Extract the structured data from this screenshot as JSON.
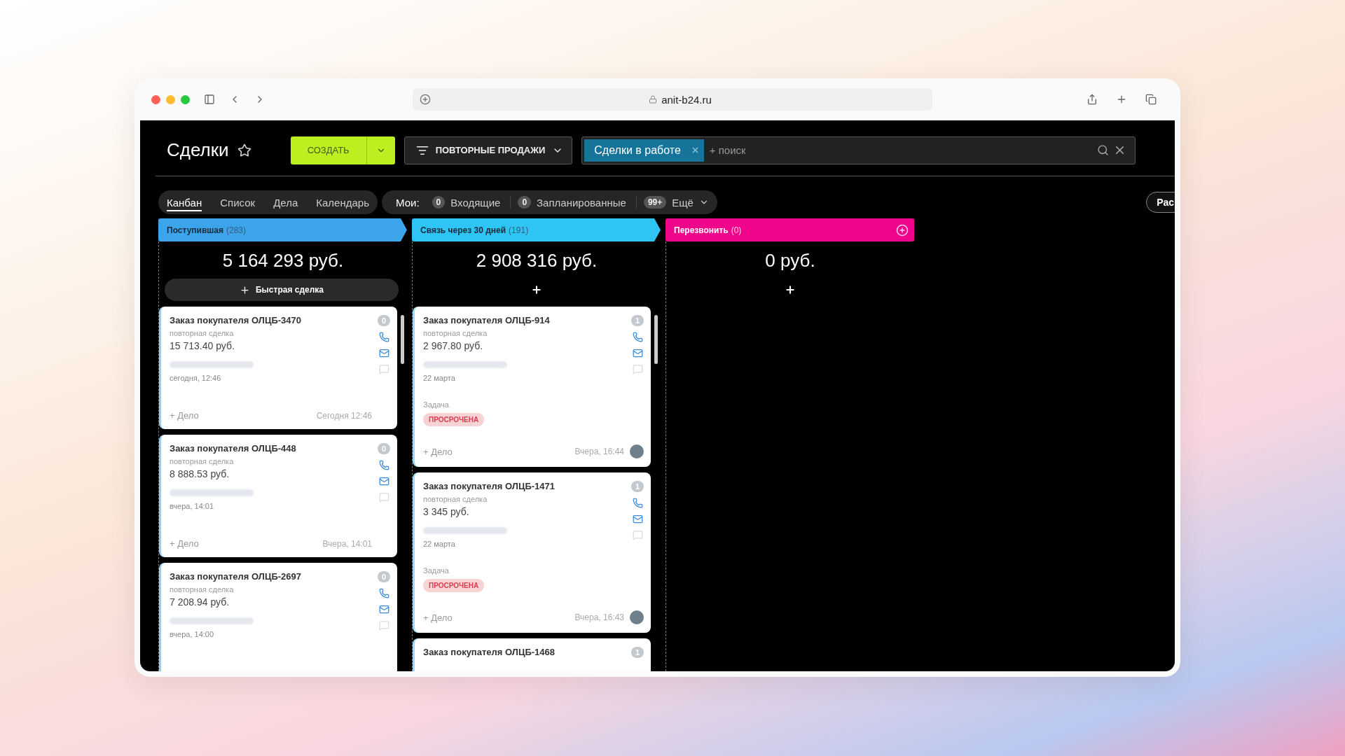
{
  "browser": {
    "url": "anit-b24.ru"
  },
  "header": {
    "title": "Сделки",
    "create_button": "СОЗДАТЬ",
    "filter_button": "ПОВТОРНЫЕ ПРОДАЖИ",
    "search": {
      "chip": "Сделки в работе",
      "placeholder": "+ поиск"
    }
  },
  "view_tabs": [
    {
      "label": "Канбан",
      "selected": true
    },
    {
      "label": "Список",
      "selected": false
    },
    {
      "label": "Дела",
      "selected": false
    },
    {
      "label": "Календарь",
      "selected": false
    }
  ],
  "counters": {
    "label": "Мои:",
    "items": [
      {
        "count": "0",
        "label": "Входящие"
      },
      {
        "count": "0",
        "label": "Запланированные"
      },
      {
        "count": "99+",
        "label": "Ещё",
        "kind": "more"
      }
    ]
  },
  "right_button": "Рас",
  "columns": [
    {
      "title": "Поступившая",
      "count": "(283)",
      "color": "#3ba4ea",
      "total": "5 164 293 руб.",
      "header_plus": false,
      "add": {
        "kind": "quick",
        "label": "Быстрая сделка"
      },
      "cards": [
        {
          "title": "Заказ покупателя ОЛЦБ-3470",
          "badge": "0",
          "type": "повторная сделка",
          "amount": "15 713.40 руб.",
          "date": "сегодня, 12:46",
          "add_activity": "+ Дело",
          "last_activity": "Сегодня 12:46",
          "avatar": false
        },
        {
          "title": "Заказ покупателя ОЛЦБ-448",
          "badge": "0",
          "type": "повторная сделка",
          "amount": "8 888.53 руб.",
          "date": "вчера, 14:01",
          "add_activity": "+ Дело",
          "last_activity": "Вчера, 14:01",
          "avatar": false
        },
        {
          "title": "Заказ покупателя ОЛЦБ-2697",
          "badge": "0",
          "type": "повторная сделка",
          "amount": "7 208.94 руб.",
          "date": "вчера, 14:00"
        }
      ]
    },
    {
      "title": "Связь через 30 дней",
      "count": "(191)",
      "color": "#2ec5f4",
      "total": "2 908 316 руб.",
      "header_plus": false,
      "add": {
        "kind": "plus"
      },
      "cards": [
        {
          "title": "Заказ покупателя ОЛЦБ-914",
          "badge": "1",
          "type": "повторная сделка",
          "amount": "2 967.80 руб.",
          "date": "22 марта",
          "task": {
            "label": "Задача",
            "status": "ПРОСРОЧЕНА"
          },
          "add_activity": "+ Дело",
          "last_activity": "Вчера, 16:44",
          "avatar": true
        },
        {
          "title": "Заказ покупателя ОЛЦБ-1471",
          "badge": "1",
          "type": "повторная сделка",
          "amount": "3 345 руб.",
          "date": "22 марта",
          "task": {
            "label": "Задача",
            "status": "ПРОСРОЧЕНА"
          },
          "add_activity": "+ Дело",
          "last_activity": "Вчера, 16:43",
          "avatar": true
        },
        {
          "title": "Заказ покупателя ОЛЦБ-1468",
          "badge": "1"
        }
      ]
    },
    {
      "title": "Перезвонить",
      "count": "(0)",
      "color": "#f0048c",
      "total": "0 руб.",
      "header_plus": true,
      "add": {
        "kind": "plus"
      }
    }
  ]
}
